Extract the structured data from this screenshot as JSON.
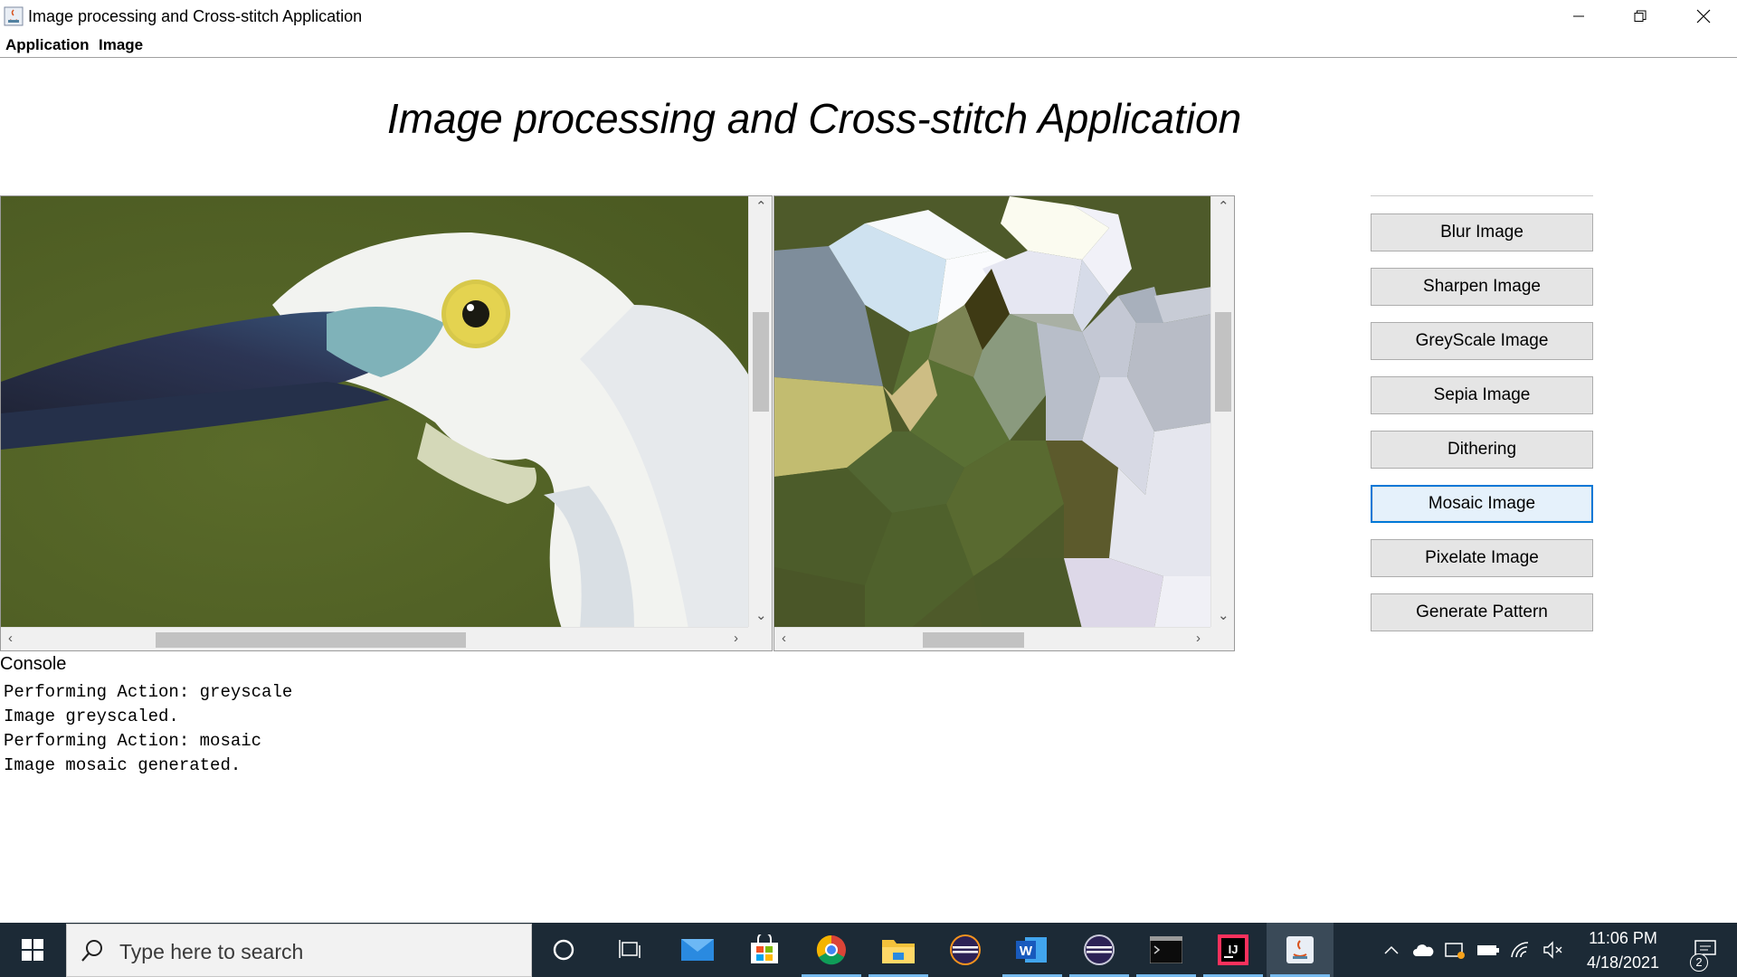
{
  "window": {
    "title": "Image processing and Cross-stitch Application"
  },
  "menubar": {
    "items": [
      "Application",
      "Image"
    ]
  },
  "main": {
    "heading": "Image processing and Cross-stitch Application"
  },
  "actions": {
    "buttons": [
      "Blur Image",
      "Sharpen Image",
      "GreyScale Image",
      "Sepia Image",
      "Dithering",
      "Mosaic Image",
      "Pixelate Image",
      "Generate Pattern"
    ],
    "focused": "Mosaic Image"
  },
  "console": {
    "label": "Console",
    "lines": [
      "Performing Action: greyscale",
      "Image greyscaled.",
      "Performing Action: mosaic",
      "Image mosaic generated."
    ]
  },
  "taskbar": {
    "search_placeholder": "Type here to search",
    "time": "11:06 PM",
    "date": "4/18/2021",
    "notification_count": "2",
    "pinned": [
      "cortana-icon",
      "task-view-icon",
      "mail-icon",
      "store-icon",
      "chrome-icon",
      "file-explorer-icon",
      "eclipse-icon",
      "word-icon",
      "eclipse-icon",
      "terminal-icon",
      "intellij-icon",
      "java-icon"
    ]
  },
  "colors": {
    "accent": "#0078d7",
    "taskbar": "#1c2a36",
    "button_face": "#e5e5e5"
  }
}
